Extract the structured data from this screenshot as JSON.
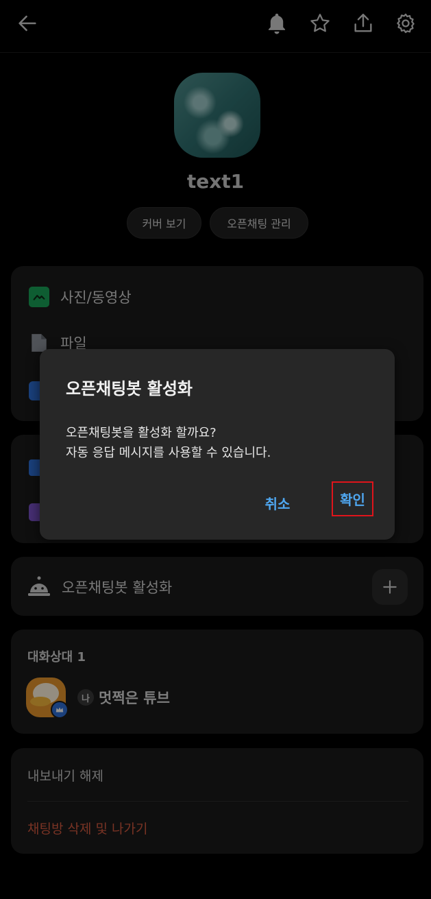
{
  "topbar": {
    "back": "back-arrow-icon",
    "icons": [
      "bell-icon",
      "star-icon",
      "share-icon",
      "gear-icon"
    ]
  },
  "profile": {
    "name": "text1",
    "buttons": [
      "커버 보기",
      "오픈채팅 관리"
    ]
  },
  "media_card": {
    "items": [
      {
        "label": "사진/동영상",
        "icon": "photo-icon",
        "color": "#19a056"
      },
      {
        "label": "파일",
        "icon": "file-icon",
        "color": "#8a8f98"
      }
    ]
  },
  "bot_card": {
    "label": "오픈채팅봇 활성화",
    "icon": "bot-bell-icon",
    "add_icon": "plus-icon"
  },
  "members_card": {
    "title": "대화상대 1",
    "me_badge": "나",
    "member_name": "멋쩍은 튜브"
  },
  "bottom_card": {
    "unexport": "내보내기 해제",
    "delete_leave": "채팅방 삭제 및 나가기"
  },
  "dialog": {
    "title": "오픈채팅봇 활성화",
    "message_line1": "오픈채팅봇을 활성화 할까요?",
    "message_line2": "자동 응답 메시지를 사용할 수 있습니다.",
    "cancel": "취소",
    "confirm": "확인"
  },
  "colors": {
    "accent": "#4fa7f0",
    "danger": "#d0583f",
    "highlight": "#e0141b"
  }
}
